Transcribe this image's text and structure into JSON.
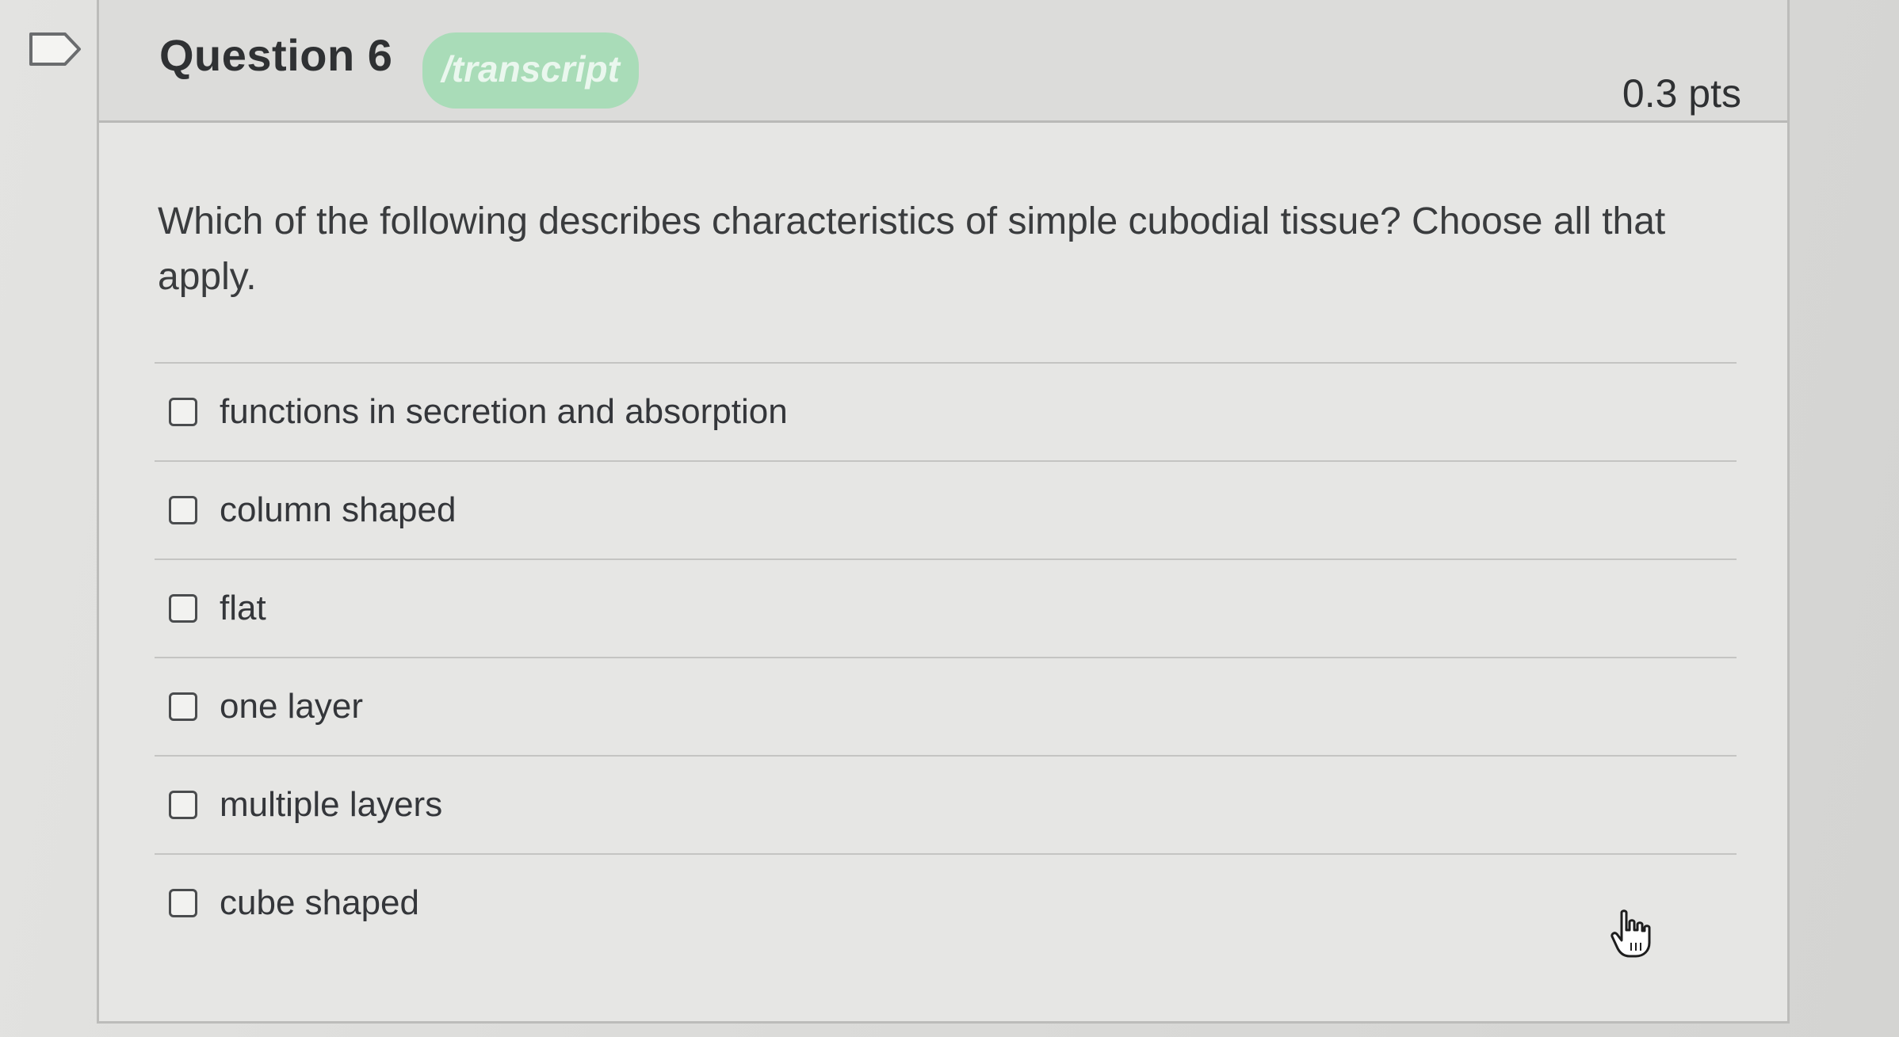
{
  "question": {
    "title": "Question 6",
    "badge": "/transcript",
    "points": "0.3 pts",
    "text": "Which of the following describes characteristics of simple cubodial tissue?  Choose all that apply."
  },
  "answers": [
    {
      "label": "functions in secretion and absorption",
      "checked": false
    },
    {
      "label": "column shaped",
      "checked": false
    },
    {
      "label": "flat",
      "checked": false
    },
    {
      "label": "one layer",
      "checked": false
    },
    {
      "label": "multiple layers",
      "checked": false
    },
    {
      "label": "cube shaped",
      "checked": false
    }
  ],
  "icons": {
    "flag": "flag-question-icon",
    "cursor": "hand-pointer-icon"
  },
  "colors": {
    "badge": "#a9dcb8",
    "text": "#2f3133",
    "border": "#bcbcba"
  }
}
